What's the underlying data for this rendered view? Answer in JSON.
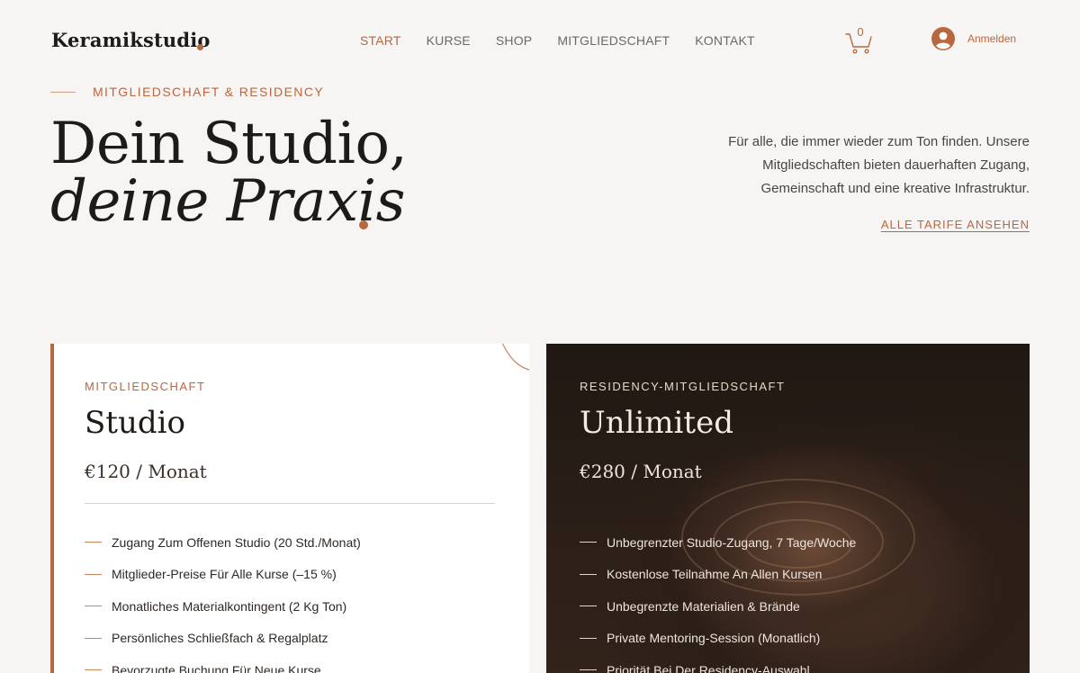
{
  "header": {
    "logo": "Keramikstudio",
    "nav": [
      {
        "label": "START",
        "active": true
      },
      {
        "label": "KURSE",
        "active": false
      },
      {
        "label": "SHOP",
        "active": false
      },
      {
        "label": "MITGLIEDSCHAFT",
        "active": false
      },
      {
        "label": "KONTAKT",
        "active": false
      }
    ],
    "cart_count": "0",
    "cart_icon": "cart-icon",
    "login_label": "Anmelden",
    "login_icon": "avatar-icon"
  },
  "hero": {
    "eyebrow": "MITGLIEDSCHAFT & RESIDENCY",
    "title_line1": "Dein Studio,",
    "title_line2": "deine Praxis",
    "description": "Für alle, die immer wieder zum Ton finden. Unsere Mitgliedschaften bieten dauerhaften Zugang, Gemeinschaft und eine kreative Infrastruktur.",
    "link_label": "ALLE TARIFE ANSEHEN"
  },
  "plans": [
    {
      "label": "MITGLIEDSCHAFT",
      "name": "Studio",
      "price": "€120 / Monat",
      "features": [
        "Zugang Zum Offenen Studio (20 Std./Monat)",
        "Mitglieder-Preise Für Alle Kurse (–15 %)",
        "Monatliches Materialkontingent (2 Kg Ton)",
        "Persönliches Schließfach & Regalplatz",
        "Bevorzugte Buchung Für Neue Kurse"
      ]
    },
    {
      "label": "RESIDENCY-MITGLIEDSCHAFT",
      "name": "Unlimited",
      "price": "€280 / Monat",
      "features": [
        "Unbegrenzter Studio-Zugang, 7 Tage/Woche",
        "Kostenlose Teilnahme An Allen Kursen",
        "Unbegrenzte Materialien & Brände",
        "Private Mentoring-Session (Monatlich)",
        "Priorität Bei Der Residency-Auswahl"
      ]
    }
  ],
  "colors": {
    "accent": "#b9673f",
    "background": "#f6f5f3",
    "text": "#1d1a17"
  }
}
